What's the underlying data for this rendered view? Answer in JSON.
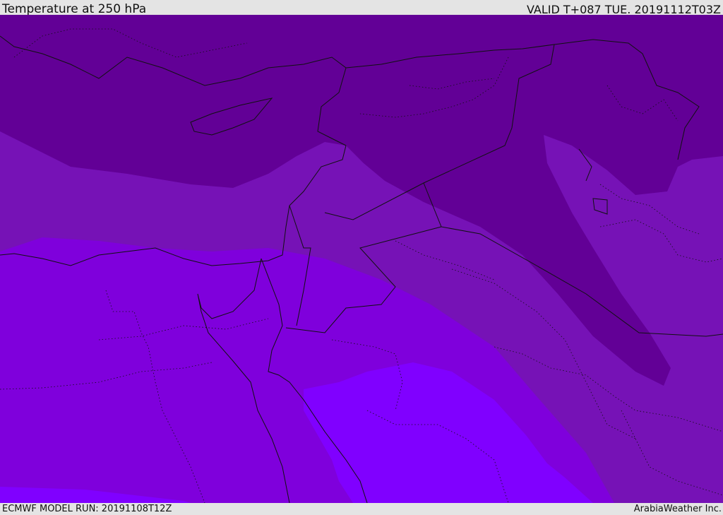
{
  "header": {
    "title": "Temperature at 250 hPa",
    "valid": "VALID T+087 TUE. 20191112T03Z"
  },
  "footer": {
    "model_run": "ECMWF MODEL RUN: 20191108T12Z",
    "credit": "ArabiaWeather Inc."
  },
  "map": {
    "field": "temperature-250hPa",
    "colors": {
      "coldest": "#620096",
      "cold": "#7612b6",
      "mid": "#7f00dc",
      "warm": "#8000ff"
    }
  }
}
